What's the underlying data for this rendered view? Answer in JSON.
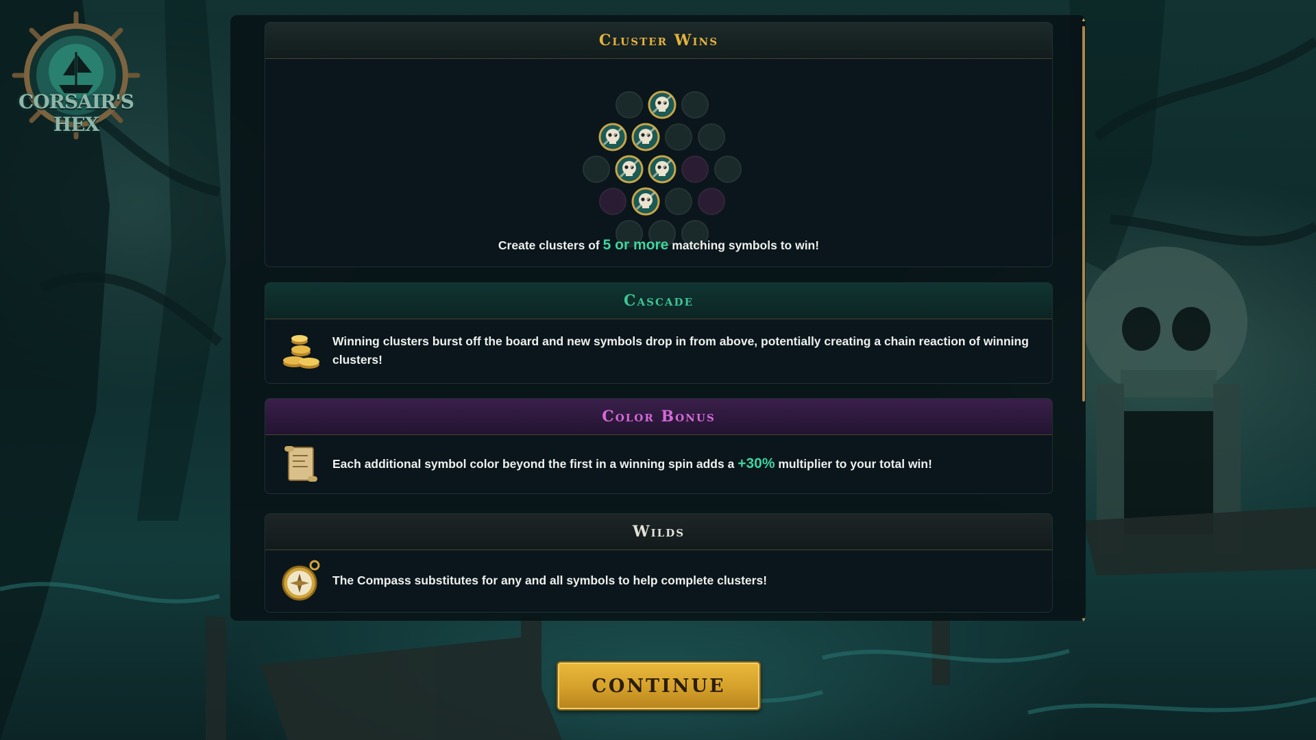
{
  "game": {
    "title": "CORSAIR'S HEX"
  },
  "sections": {
    "cluster_wins": {
      "title": "Cluster Wins",
      "caption_before": "Create clusters of ",
      "caption_highlight": "5 or more",
      "caption_after": " matching symbols to win!"
    },
    "cascade": {
      "title": "Cascade",
      "text": "Winning clusters burst off the board and new symbols drop in from above, potentially creating a chain reaction of winning clusters!",
      "icon": "gold-coins-icon"
    },
    "color_bonus": {
      "title": "Color Bonus",
      "text_before": "Each additional symbol color beyond the first in a winning spin adds a ",
      "text_highlight": "+30%",
      "text_after": " multiplier to your total win!",
      "icon": "scroll-map-icon"
    },
    "wilds": {
      "title": "Wilds",
      "text": "The Compass substitutes for any and all symbols to help complete clusters!",
      "icon": "compass-icon"
    }
  },
  "continue_button": {
    "label": "CONTINUE"
  },
  "colors": {
    "gold": "#e5b33d",
    "teal": "#3ec497",
    "purple": "#d46ad9",
    "highlight": "#3fd49f"
  }
}
